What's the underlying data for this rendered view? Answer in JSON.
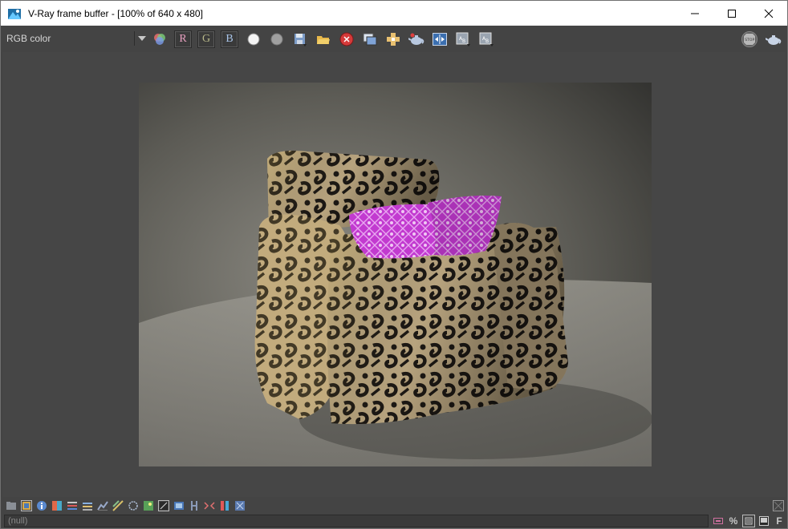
{
  "window": {
    "title": "V-Ray frame buffer - [100% of 640 x 480]",
    "app_icon": "vray-frame-buffer-icon",
    "controls": {
      "minimize": "minimize-icon",
      "maximize": "maximize-icon",
      "close": "close-icon"
    }
  },
  "toolbar": {
    "channel": "RGB color",
    "buttons": [
      "channel-dropdown-arrow-icon",
      "rgb-circles-icon",
      "R",
      "G",
      "B",
      "white-circle-icon",
      "gray-circle-icon",
      "save-image-icon",
      "open-image-icon",
      "clear-image-icon",
      "duplicate-to-max-icon",
      "track-mouse-icon",
      "render-teapot-icon",
      "compare-ab-icon",
      "history-a-icon",
      "history-b-icon",
      "stop-icon",
      "render-last-teapot-icon"
    ]
  },
  "render": {
    "image": "Rendered armchair draped with patterned cloth and two magenta cushions"
  },
  "bottom_toolbar": {
    "icons": [
      "folder-icon",
      "color-correction-icon",
      "info-icon",
      "color-balance-icon",
      "levels-icon",
      "lut-icon",
      "curve-icon",
      "exposure-icon",
      "color-picker-icon",
      "lens-effects-icon",
      "region-icon",
      "region-render-icon",
      "hdr-icon",
      "horizontal-flip-icon",
      "vertical-flip-icon",
      "stereo-icon",
      "pixel-info-icon"
    ]
  },
  "statusbar": {
    "text": "(null)",
    "right_icons": [
      "stamp-icon",
      "percent-icon",
      "log-icon",
      "window-icon",
      "font-icon"
    ],
    "percent_label": "%",
    "font_label": "F"
  },
  "colors": {
    "frame_bg": "#444444",
    "title_bg": "#ffffff",
    "cushion": "#c23ad0",
    "cloth_gold": "#b89a5e"
  }
}
